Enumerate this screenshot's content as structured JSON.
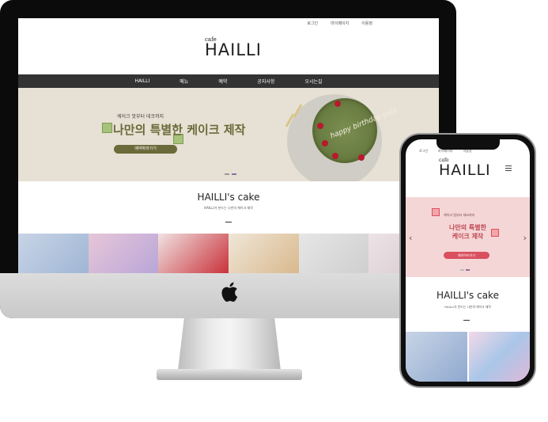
{
  "desktop": {
    "top_links": [
      "로그인",
      "마이페이지",
      "이용정"
    ],
    "logo_small": "cafe",
    "logo": "HAILLI",
    "menu": [
      "HAILLI",
      "메뉴",
      "예약",
      "공지사항",
      "오시는길"
    ],
    "hero": {
      "subtitle": "케이크 맛부터 데코까지",
      "title": "나만의 특별한 케이크 제작",
      "button": "예약하러가기",
      "cake_text": "happy birthday yuls"
    },
    "section": {
      "title": "HAILLI's cake",
      "subtitle": "HAILLI가 만드는 나만의 케이크 제작"
    }
  },
  "mobile": {
    "top_links": [
      "로그인",
      "마이페이지",
      "이용정"
    ],
    "logo_small": "cafe",
    "logo": "HAILLI",
    "hero": {
      "subtitle": "케이크 맛부터 데코까지",
      "title_line1": "나만의 특별한",
      "title_line2": "케이크 제작",
      "button": "예약하러가기"
    },
    "section": {
      "title": "HAILLI's cake",
      "subtitle": "HAILLI가 만드는 나만의 케이크 제작"
    }
  },
  "colors": {
    "gnb": "#333333",
    "hero_desktop_bg": "#e6e1d4",
    "hero_desktop_accent": "#6b6a3a",
    "hero_mobile_bg": "#f5d6d6",
    "hero_mobile_accent": "#d9505f"
  },
  "icons": [
    "apple-logo-icon",
    "hamburger-menu-icon",
    "chevron-left-icon",
    "chevron-right-icon"
  ]
}
